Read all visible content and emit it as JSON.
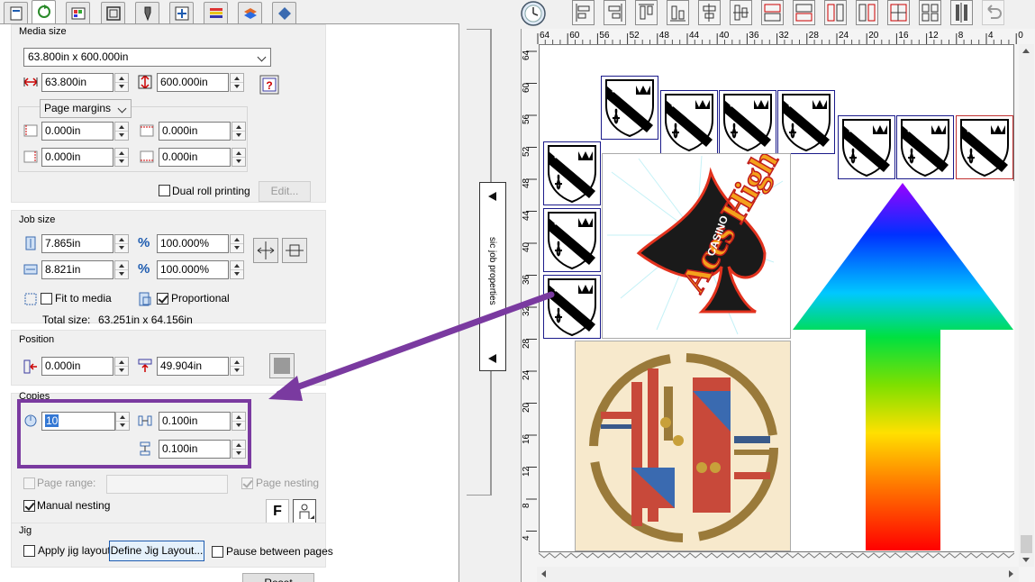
{
  "tabs": [
    "general",
    "color",
    "file",
    "layout",
    "pen",
    "marks",
    "strip",
    "stack",
    "tile"
  ],
  "media": {
    "title": "Media size",
    "preset": "63.800in x 600.000in",
    "width": "63.800in",
    "height": "600.000in",
    "margins_label": "Page margins",
    "margin_left": "0.000in",
    "margin_top": "0.000in",
    "margin_right": "0.000in",
    "margin_bottom": "0.000in",
    "dual_roll_label": "Dual roll printing",
    "edit_label": "Edit..."
  },
  "job": {
    "title": "Job size",
    "height": "7.865in",
    "width": "8.821in",
    "height_pct": "100.000%",
    "width_pct": "100.000%",
    "pct_symbol": "%",
    "fit_label": "Fit to media",
    "proportional_label": "Proportional",
    "total_label": "Total size:",
    "total_value": "63.251in x 64.156in"
  },
  "position": {
    "title": "Position",
    "x": "0.000in",
    "y": "49.904in"
  },
  "copies": {
    "title": "Copies",
    "count": "10",
    "h_gap": "0.100in",
    "v_gap": "0.100in",
    "page_range_label": "Page range:",
    "page_nesting_label": "Page nesting",
    "manual_nesting_label": "Manual nesting",
    "f_label": "F"
  },
  "jig": {
    "title": "Jig",
    "apply_label": "Apply jig layout",
    "define_label": "Define Jig Layout...",
    "pause_label": "Pause between pages",
    "reset_label": "Reset"
  },
  "side_handle": {
    "label": "sic job properties"
  },
  "ruler": {
    "top_ticks": [
      "64",
      "60",
      "56",
      "52",
      "48",
      "44",
      "40",
      "36",
      "32",
      "28",
      "24",
      "20",
      "16",
      "12",
      "8",
      "4",
      "0"
    ],
    "left_ticks": [
      "64",
      "60",
      "56",
      "52",
      "48",
      "44",
      "40",
      "36",
      "32",
      "28",
      "24",
      "20",
      "16",
      "12",
      "8",
      "4"
    ]
  },
  "artwork": {
    "logo_text": "Aces High",
    "logo_sub": "CASINO"
  },
  "colors": {
    "highlight": "#7a3aa0",
    "accent": "#1e5cb0"
  }
}
